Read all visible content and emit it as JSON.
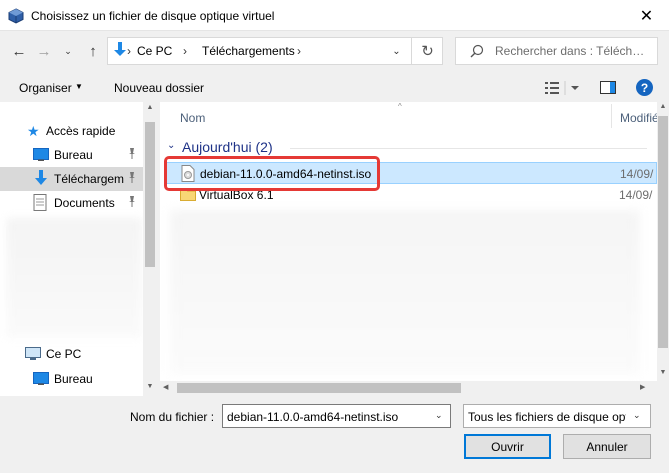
{
  "window": {
    "title": "Choisissez un fichier de disque optique virtuel",
    "close_glyph": "✕"
  },
  "nav": {
    "back_glyph": "←",
    "forward_glyph": "→",
    "recent_glyph": "⌄",
    "up_glyph": "↑",
    "refresh_glyph": "↻",
    "breadcrumb": [
      "Ce PC",
      "Téléchargements"
    ],
    "crumb_sep": "›",
    "dropdown_glyph": "⌄"
  },
  "search": {
    "placeholder": "Rechercher dans : Téléchargements"
  },
  "toolbar": {
    "organise_label": "Organiser",
    "organise_caret": "▼",
    "new_folder_label": "Nouveau dossier",
    "help_label": "?"
  },
  "sidebar": {
    "quick_access": "Accès rapide",
    "items": [
      {
        "label": "Bureau",
        "icon": "desktop-icon",
        "pinned": true
      },
      {
        "label": "Téléchargements",
        "icon": "download-icon",
        "pinned": true,
        "selected": true
      },
      {
        "label": "Documents",
        "icon": "document-icon",
        "pinned": true
      }
    ],
    "this_pc": "Ce PC",
    "pc_items": [
      {
        "label": "Bureau",
        "icon": "desktop-icon"
      }
    ],
    "pin_glyph": "📌"
  },
  "filelist": {
    "columns": {
      "name": "Nom",
      "modified": "Modifié le"
    },
    "sort_glyph": "^",
    "group_chevron": "⌄",
    "group_label": "Aujourd'hui (2)",
    "files": [
      {
        "name": "debian-11.0.0-amd64-netinst.iso",
        "date": "14/09/",
        "icon": "disc-image-icon",
        "selected": true
      },
      {
        "name": "VirtualBox 6.1",
        "date": "14/09/",
        "icon": "folder-icon",
        "selected": false
      }
    ]
  },
  "bottom": {
    "filename_label": "Nom du fichier :",
    "filename_value": "debian-11.0.0-amd64-netinst.iso",
    "filetype_value": "Tous les fichiers de disque optique",
    "open_label": "Ouvrir",
    "cancel_label": "Annuler",
    "caret_glyph": "⌄"
  },
  "scroll_glyphs": {
    "up": "▲",
    "down": "▼",
    "left": "◀",
    "right": "▶"
  },
  "colors": {
    "accent": "#0078d7",
    "selection": "#cce8ff",
    "highlight_border": "#e53935",
    "group_header": "#1e3287"
  }
}
